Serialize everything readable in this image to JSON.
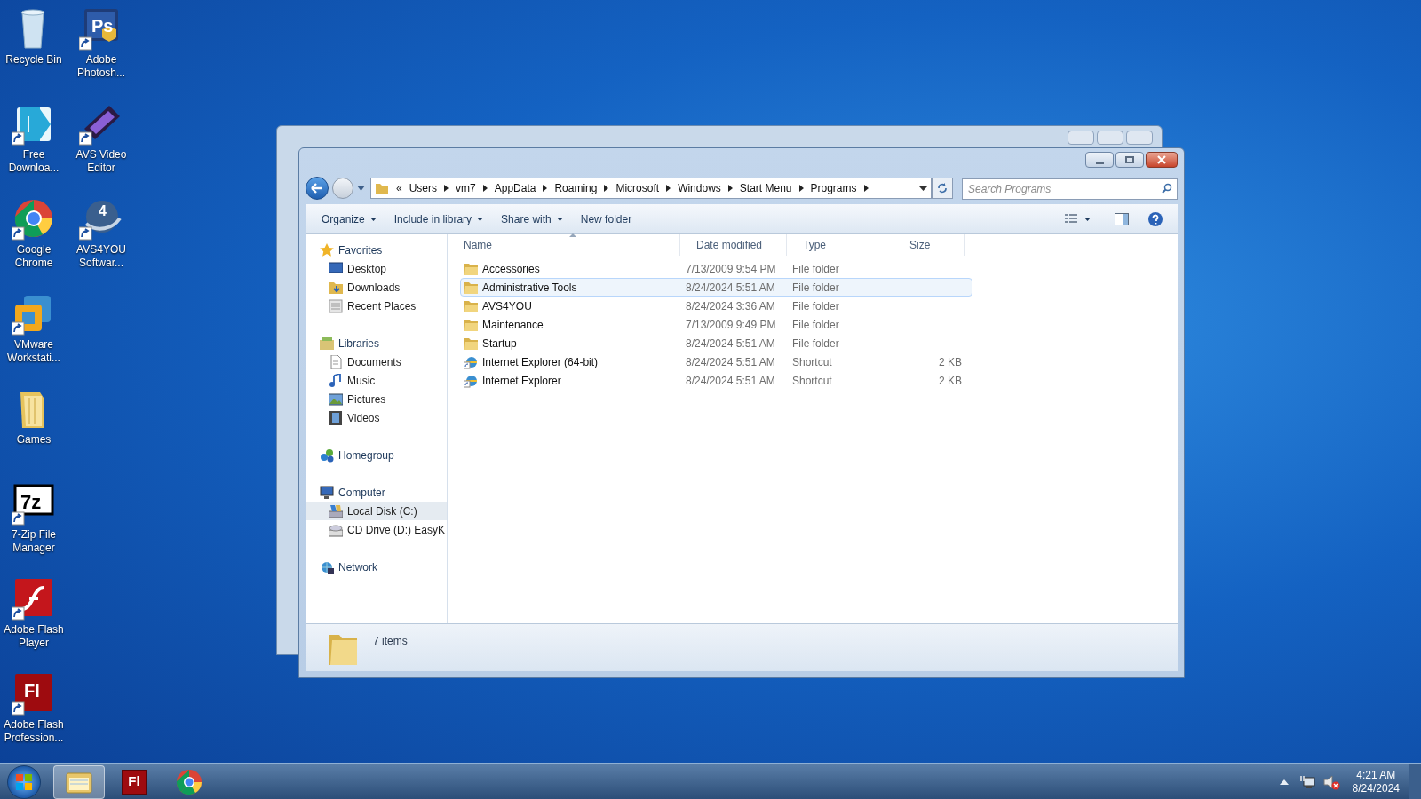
{
  "desktop_icons": [
    {
      "label": "Recycle Bin",
      "kind": "recycle",
      "shortcut": false
    },
    {
      "label": "Free Downloa...",
      "kind": "download",
      "shortcut": true
    },
    {
      "label": "Google Chrome",
      "kind": "chrome",
      "shortcut": true
    },
    {
      "label": "VMware Workstati...",
      "kind": "vmware",
      "shortcut": true
    },
    {
      "label": "Games",
      "kind": "games",
      "shortcut": false
    },
    {
      "label": "7-Zip File Manager",
      "kind": "sevenzip",
      "glyph": "7z",
      "shortcut": true
    },
    {
      "label": "Adobe Flash Player",
      "kind": "flash",
      "shortcut": true
    },
    {
      "label": "Adobe Flash Profession...",
      "kind": "fl",
      "glyph": "Fl",
      "shortcut": true
    },
    {
      "label": "Adobe Photosh...",
      "kind": "ps",
      "glyph": "Ps",
      "shortcut": true
    },
    {
      "label": "AVS Video Editor",
      "kind": "film",
      "shortcut": true
    },
    {
      "label": "AVS4YOU Softwar...",
      "kind": "avs",
      "glyph": "4",
      "shortcut": true
    }
  ],
  "window": {
    "address": {
      "overflow_mark": "«",
      "crumbs": [
        "Users",
        "vm7",
        "AppData",
        "Roaming",
        "Microsoft",
        "Windows",
        "Start Menu",
        "Programs"
      ]
    },
    "search": {
      "placeholder": "Search Programs"
    },
    "toolbar": [
      {
        "label": "Organize",
        "dropdown": true
      },
      {
        "label": "Include in library",
        "dropdown": true
      },
      {
        "label": "Share with",
        "dropdown": true
      },
      {
        "label": "New folder",
        "dropdown": false
      }
    ],
    "nav": [
      {
        "label": "Favorites",
        "kind": "star",
        "children": [
          {
            "label": "Desktop",
            "kind": "desktop",
            "selected": false
          },
          {
            "label": "Downloads",
            "kind": "downloads",
            "selected": false
          },
          {
            "label": "Recent Places",
            "kind": "recent",
            "selected": false
          }
        ]
      },
      {
        "label": "Libraries",
        "kind": "library",
        "children": [
          {
            "label": "Documents",
            "kind": "document",
            "selected": false
          },
          {
            "label": "Music",
            "kind": "music",
            "selected": false
          },
          {
            "label": "Pictures",
            "kind": "pictures",
            "selected": false
          },
          {
            "label": "Videos",
            "kind": "videos",
            "selected": false
          }
        ]
      },
      {
        "label": "Homegroup",
        "kind": "homegroup"
      },
      {
        "label": "Computer",
        "kind": "computer",
        "children": [
          {
            "label": "Local Disk (C:)",
            "kind": "disk",
            "selected": true
          },
          {
            "label": "CD Drive (D:) EasyK",
            "kind": "cd",
            "selected": false
          }
        ]
      },
      {
        "label": "Network",
        "kind": "network"
      }
    ],
    "columns": [
      "Name",
      "Date modified",
      "Type",
      "Size"
    ],
    "rows": [
      {
        "name": "Accessories",
        "date": "7/13/2009 9:54 PM",
        "type": "File folder",
        "kind": "folder",
        "highlighted": false
      },
      {
        "name": "Administrative Tools",
        "date": "8/24/2024 5:51 AM",
        "type": "File folder",
        "kind": "folder",
        "highlighted": true
      },
      {
        "name": "AVS4YOU",
        "date": "8/24/2024 3:36 AM",
        "type": "File folder",
        "kind": "folder",
        "highlighted": false
      },
      {
        "name": "Maintenance",
        "date": "7/13/2009 9:49 PM",
        "type": "File folder",
        "kind": "folder",
        "highlighted": false
      },
      {
        "name": "Startup",
        "date": "8/24/2024 5:51 AM",
        "type": "File folder",
        "kind": "folder",
        "highlighted": false
      },
      {
        "name": "Internet Explorer (64-bit)",
        "date": "8/24/2024 5:51 AM",
        "type": "Shortcut",
        "size": "2 KB",
        "kind": "shortcut",
        "highlighted": false
      },
      {
        "name": "Internet Explorer",
        "date": "8/24/2024 5:51 AM",
        "type": "Shortcut",
        "size": "2 KB",
        "kind": "shortcut",
        "highlighted": false
      }
    ],
    "status": "7 items"
  },
  "taskbar": {
    "buttons": [
      {
        "kind": "explorer",
        "active": true
      },
      {
        "kind": "fl",
        "glyph": "Fl",
        "active": false
      },
      {
        "kind": "chrome",
        "active": false
      }
    ],
    "clock": {
      "time": "4:21 AM",
      "date": "8/24/2024"
    }
  }
}
